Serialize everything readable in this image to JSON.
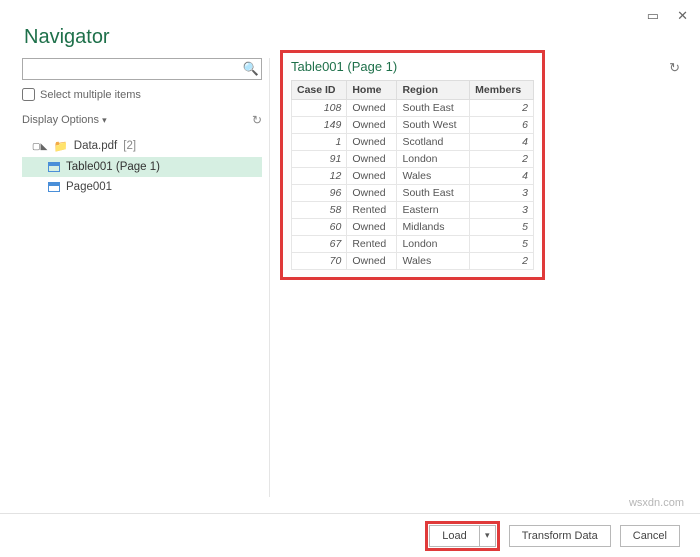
{
  "title": "Navigator",
  "search": {
    "placeholder": ""
  },
  "checkbox_label": "Select multiple items",
  "display_options_label": "Display Options",
  "tree": {
    "root_label": "Data.pdf",
    "root_count": "[2]",
    "children": [
      {
        "label": "Table001 (Page 1)",
        "selected": true,
        "kind": "table"
      },
      {
        "label": "Page001",
        "selected": false,
        "kind": "table"
      }
    ]
  },
  "preview": {
    "title": "Table001 (Page 1)",
    "columns": [
      "Case ID",
      "Home",
      "Region",
      "Members"
    ]
  },
  "chart_data": {
    "type": "table",
    "columns": [
      "Case ID",
      "Home",
      "Region",
      "Members"
    ],
    "rows": [
      [
        108,
        "Owned",
        "South East",
        2
      ],
      [
        149,
        "Owned",
        "South West",
        6
      ],
      [
        1,
        "Owned",
        "Scotland",
        4
      ],
      [
        91,
        "Owned",
        "London",
        2
      ],
      [
        12,
        "Owned",
        "Wales",
        4
      ],
      [
        96,
        "Owned",
        "South East",
        3
      ],
      [
        58,
        "Rented",
        "Eastern",
        3
      ],
      [
        60,
        "Owned",
        "Midlands",
        5
      ],
      [
        67,
        "Rented",
        "London",
        5
      ],
      [
        70,
        "Owned",
        "Wales",
        2
      ]
    ]
  },
  "footer": {
    "load": "Load",
    "transform": "Transform Data",
    "cancel": "Cancel"
  },
  "watermark": "wsxdn.com"
}
